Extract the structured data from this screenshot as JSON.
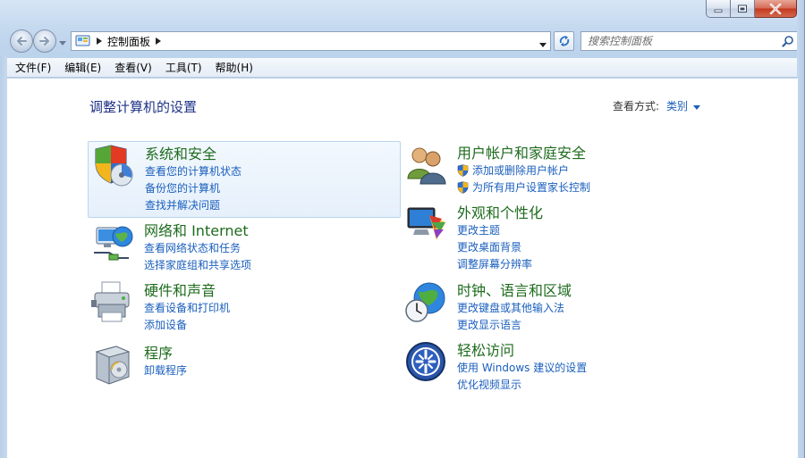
{
  "window": {
    "minimize_glyph": "–",
    "maximize_glyph": "□",
    "close_glyph": "✕"
  },
  "address": {
    "path": "控制面板",
    "separator_glyph": "▶",
    "search_placeholder": "搜索控制面板"
  },
  "menu": [
    {
      "label": "文件(F)"
    },
    {
      "label": "编辑(E)"
    },
    {
      "label": "查看(V)"
    },
    {
      "label": "工具(T)"
    },
    {
      "label": "帮助(H)"
    }
  ],
  "page": {
    "title": "调整计算机的设置",
    "view_by_label": "查看方式:",
    "view_by_value": "类别"
  },
  "categories": [
    {
      "title": "系统和安全",
      "icon": "system-security-shield-icon",
      "selected": true,
      "links": [
        "查看您的计算机状态",
        "备份您的计算机",
        "查找并解决问题"
      ]
    },
    {
      "title": "网络和 Internet",
      "icon": "network-globe-icon",
      "links": [
        "查看网络状态和任务",
        "选择家庭组和共享选项"
      ]
    },
    {
      "title": "硬件和声音",
      "icon": "printer-hardware-icon",
      "links": [
        "查看设备和打印机",
        "添加设备"
      ]
    },
    {
      "title": "程序",
      "icon": "programs-box-icon",
      "links": [
        "卸载程序"
      ]
    },
    {
      "title": "用户帐户和家庭安全",
      "icon": "user-accounts-icon",
      "links": [
        "添加或删除用户帐户",
        "为所有用户设置家长控制"
      ]
    },
    {
      "title": "外观和个性化",
      "icon": "appearance-monitor-icon",
      "links": [
        "更改主题",
        "更改桌面背景",
        "调整屏幕分辨率"
      ]
    },
    {
      "title": "时钟、语言和区域",
      "icon": "clock-globe-icon",
      "links": [
        "更改键盘或其他输入法",
        "更改显示语言"
      ]
    },
    {
      "title": "轻松访问",
      "icon": "ease-of-access-icon",
      "links": [
        "使用 Windows 建议的设置",
        "优化视频显示"
      ]
    }
  ],
  "colors": {
    "category_title": "#1e6b1e",
    "link": "#1a5fbd",
    "page_title": "#1e3287"
  }
}
